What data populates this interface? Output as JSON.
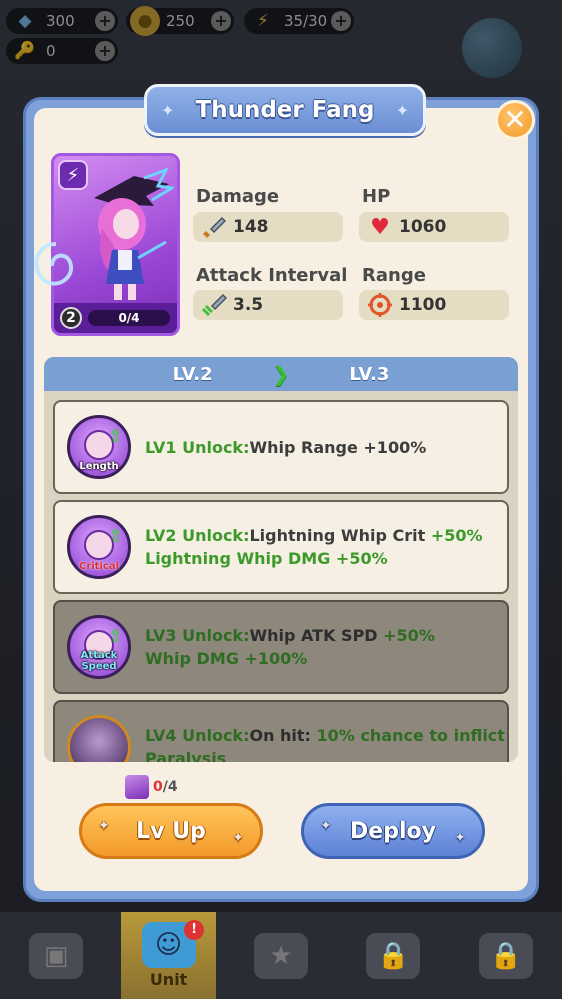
{
  "hud": {
    "gems": "300",
    "coins": "250",
    "energy": "35/30",
    "keys": "0"
  },
  "modal": {
    "title": "Thunder Fang",
    "close_icon": "close-icon"
  },
  "hero": {
    "level": "2",
    "shards": "0/4",
    "type_icon": "lightning-icon"
  },
  "stats": {
    "damage_label": "Damage",
    "damage_value": "148",
    "hp_label": "HP",
    "hp_value": "1060",
    "attack_interval_label": "Attack Interval",
    "attack_interval_value": "3.5",
    "range_label": "Range",
    "range_value": "1100"
  },
  "levels": {
    "current": "LV.2",
    "next": "LV.3"
  },
  "skills": [
    {
      "tag": "Length",
      "unlock": "LV1 Unlock:",
      "text": "Whip Range +100%",
      "highlight": "",
      "line2": ""
    },
    {
      "tag": "Critical",
      "unlock": "LV2 Unlock:",
      "text": "Lightning Whip Crit ",
      "highlight": "+50%",
      "line2": "Lightning Whip DMG +50%"
    },
    {
      "tag": "Attack Speed",
      "unlock": "LV3 Unlock:",
      "text": "Whip ATK SPD ",
      "highlight": "+50%",
      "line2": "Whip DMG +100%"
    },
    {
      "tag": "",
      "unlock": "LV4 Unlock:",
      "text": "On hit: ",
      "highlight": "10% chance to inflict",
      "line2": "Paralysis"
    }
  ],
  "footer": {
    "shard_current": "0",
    "shard_required": "/4",
    "lvup_label": "Lv Up",
    "deploy_label": "Deploy"
  },
  "nav": {
    "unit_label": "Unit",
    "unit_badge": "!"
  },
  "colors": {
    "modal_frame": "#7fa1d9",
    "panel_bg": "#f6efe2",
    "lvup": "#f39a2a",
    "deploy": "#5c82d6",
    "highlight_green": "#3c9a2a"
  }
}
